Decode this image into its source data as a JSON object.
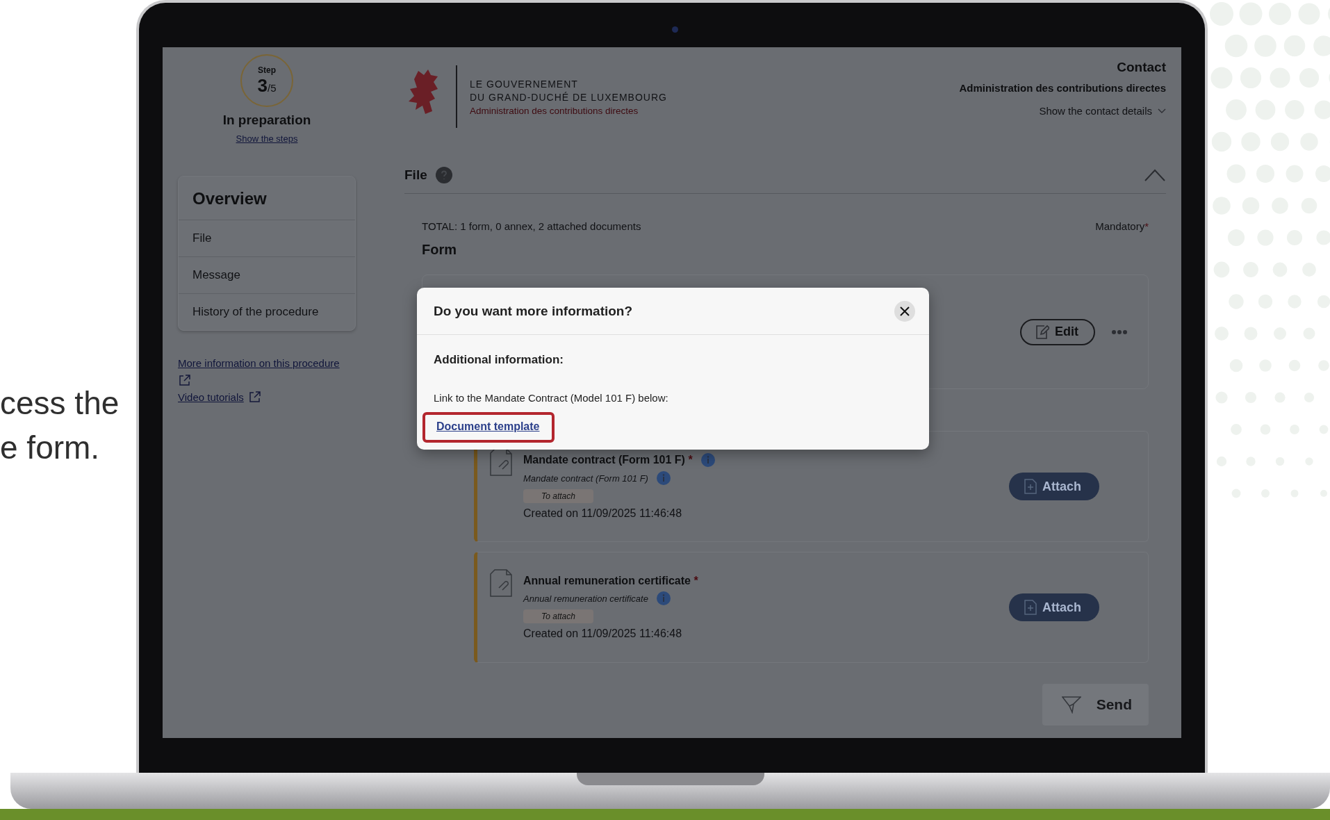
{
  "slide_text": {
    "lines": [
      "cess the",
      "e form."
    ]
  },
  "step": {
    "label": "Step",
    "current": "3",
    "total": "/5",
    "status": "In preparation",
    "link": "Show the steps"
  },
  "overview": {
    "title": "Overview",
    "items": [
      "File",
      "Message",
      "History of the procedure"
    ]
  },
  "links": [
    {
      "label": "More information on this procedure"
    },
    {
      "label": "Video tutorials"
    }
  ],
  "header": {
    "logo_lines": [
      "LE GOUVERNEMENT",
      "DU GRAND-DUCHÉ DE LUXEMBOURG"
    ],
    "logo_agency": "Administration des contributions directes",
    "contact": {
      "title": "Contact",
      "agency": "Administration des contributions directes",
      "toggle": "Show the contact details"
    }
  },
  "file_section": {
    "title": "File",
    "expanded": true,
    "total": "TOTAL: 1 form, 0 annex, 2 attached documents",
    "mandatory": "Mandatory",
    "mandatory_mark": "*",
    "form_heading": "Form",
    "edit_button": "Edit",
    "documents": [
      {
        "title": "Mandate contract (Form 101 F)",
        "required_mark": "*",
        "subtitle": "Mandate contract (Form 101 F)",
        "status": "To attach",
        "created": "Created on 11/09/2025 11:46:48",
        "button": "Attach"
      },
      {
        "title": "Annual remuneration certificate",
        "required_mark": "*",
        "subtitle": "Annual remuneration certificate",
        "status": "To attach",
        "created": "Created on 11/09/2025 11:46:48",
        "button": "Attach"
      }
    ]
  },
  "send_button": "Send",
  "modal": {
    "title": "Do you want more information?",
    "heading": "Additional information:",
    "text": "Link to the Mandate Contract (Model 101 F) below:",
    "link": "Document template",
    "link_highlighted": true
  }
}
